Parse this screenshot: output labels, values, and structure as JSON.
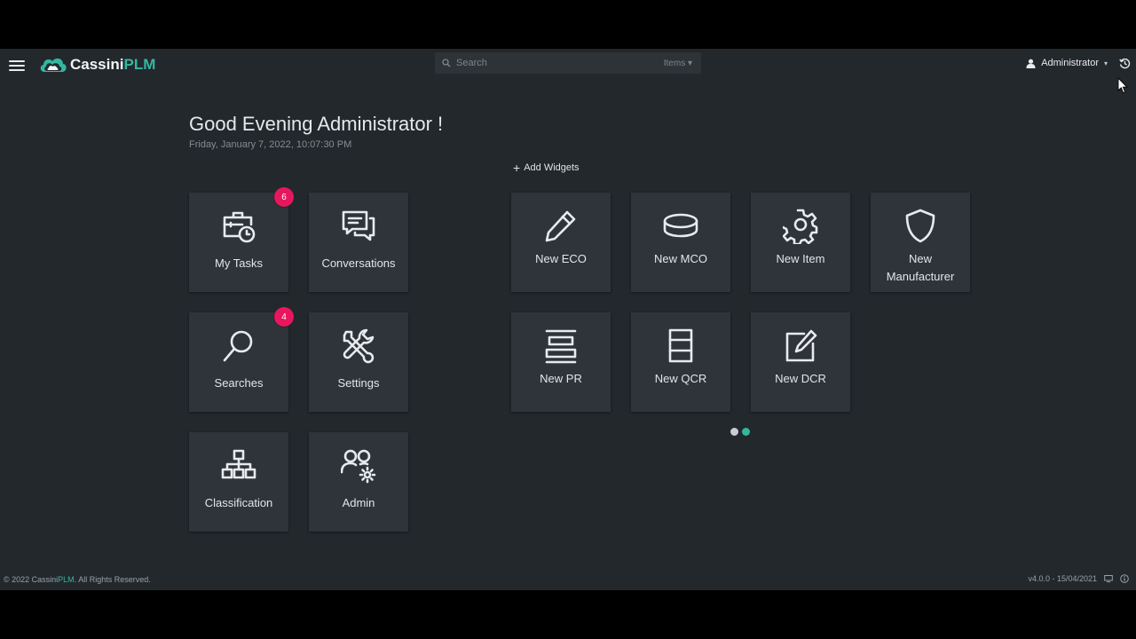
{
  "app": {
    "brand_part1": "Cassini",
    "brand_part2": "PLM",
    "accent_color": "#33b79f",
    "badge_color": "#e8175d"
  },
  "header": {
    "search_placeholder": "Search",
    "search_scope": "Items ▾",
    "user_name": "Administrator",
    "user_caret": "▾",
    "icons": [
      "menu-icon",
      "cloud-logo-icon",
      "search-icon",
      "user-icon",
      "history-icon"
    ]
  },
  "greeting": {
    "title": "Good Evening Administrator !",
    "datetime": "Friday, January 7, 2022, 10:07:30 PM"
  },
  "add_widgets": {
    "plus": "+",
    "label": "Add Widgets"
  },
  "left_tiles": [
    {
      "label": "My Tasks",
      "badge": "6",
      "icon": "tasks-icon"
    },
    {
      "label": "Conversations",
      "icon": "conversations-icon"
    },
    {
      "label": "Searches",
      "badge": "4",
      "icon": "search-icon"
    },
    {
      "label": "Settings",
      "icon": "tools-icon"
    },
    {
      "label": "Classification",
      "icon": "hierarchy-icon"
    },
    {
      "label": "Admin",
      "icon": "users-gear-icon"
    }
  ],
  "right_tiles": [
    {
      "label": "New ECO",
      "icon": "pencil-icon"
    },
    {
      "label": "New MCO",
      "icon": "database-icon"
    },
    {
      "label": "New Item",
      "icon": "gear-icon"
    },
    {
      "label": "New",
      "label2": "Manufacturer",
      "icon": "shield-icon"
    },
    {
      "label": "New PR",
      "icon": "align-icon"
    },
    {
      "label": "New QCR",
      "icon": "list-box-icon"
    },
    {
      "label": "New DCR",
      "icon": "edit-icon"
    }
  ],
  "carousel": {
    "active_index": 1,
    "count": 2,
    "inactive_color": "#c9ccd0"
  },
  "footer": {
    "copyright_prefix": "© 2022 Cassini",
    "copyright_brand": "PLM",
    "copyright_suffix": ". All Rights Reserved.",
    "version": "v4.0.0 - 15/04/2021"
  }
}
